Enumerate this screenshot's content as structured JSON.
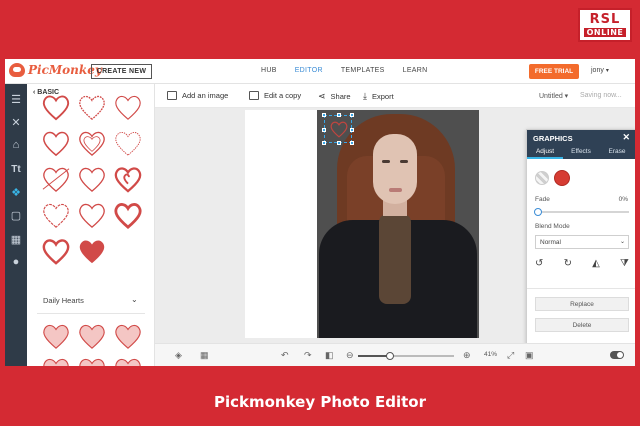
{
  "brand": {
    "line1": "RSL",
    "line2": "ONLINE"
  },
  "caption": "Pickmonkey Photo Editor",
  "app": {
    "logo_text": "PicMonkey",
    "create_new": "CREATE NEW",
    "nav": [
      "HUB",
      "EDITOR",
      "TEMPLATES",
      "LEARN"
    ],
    "nav_active": "EDITOR",
    "free_trial": "FREE TRIAL",
    "user": "jony",
    "accent_color": "#3c8dd6",
    "trial_color": "#f36b2c"
  },
  "left_tools": [
    "sliders-icon",
    "magic-wand-icon",
    "hanger-icon",
    "text-icon",
    "shapes-icon",
    "frame-icon",
    "texture-icon",
    "apple-icon"
  ],
  "panel": {
    "back_label": "BASIC",
    "section_title": "Daily Hearts"
  },
  "toolbar": {
    "add_image": "Add an image",
    "edit_copy": "Edit a copy",
    "share": "Share",
    "export": "Export",
    "doc_title": "Untitled",
    "status": "Saving now..."
  },
  "graphics_panel": {
    "title": "GRAPHICS",
    "tabs": [
      "Adjust",
      "Effects",
      "Erase"
    ],
    "active_tab": "Adjust",
    "fade_label": "Fade",
    "fade_value": "0%",
    "blend_label": "Blend Mode",
    "blend_value": "Normal",
    "replace": "Replace",
    "delete": "Delete",
    "selected_color": "#d63c33"
  },
  "bottom": {
    "zoom_value": "41%",
    "zoom_level": 0.41
  }
}
